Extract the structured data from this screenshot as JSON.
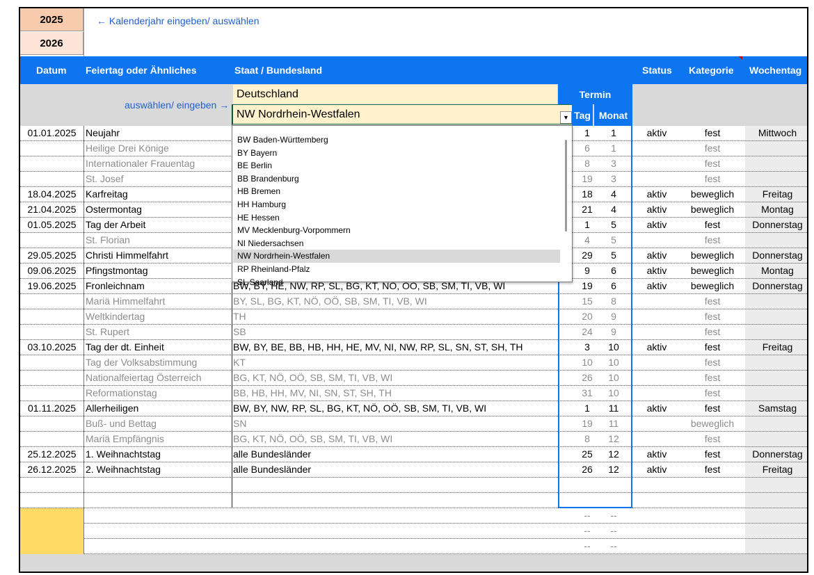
{
  "years": [
    "2025",
    "2026"
  ],
  "year_hint": "← Kalenderjahr eingeben/ auswählen",
  "headers": {
    "datum": "Datum",
    "feiertag": "Feiertag oder Ähnliches",
    "staat": "Staat / Bundesland",
    "status": "Status",
    "kategorie": "Kategorie",
    "wochentag": "Wochentag",
    "termin": "Termin",
    "tag": "Tag",
    "monat": "Monat"
  },
  "select_hint": "auswählen/ eingeben →",
  "country_value": "Deutschland",
  "state_value": "NW Nordrhein-Westfalen",
  "dropdown_arrow": "▼",
  "dropdown": {
    "items": [
      "BW Baden-Württemberg",
      "BY Bayern",
      "BE Berlin",
      "BB Brandenburg",
      "HB Bremen",
      "HH Hamburg",
      "HE Hessen",
      "MV Mecklenburg-Vorpommern",
      "NI Niedersachsen",
      "NW Nordrhein-Westfalen",
      "RP Rheinland-Pfalz",
      "SL Saarland"
    ],
    "selected_index": 9
  },
  "rows": [
    {
      "date": "01.01.2025",
      "name": "Neujahr",
      "states": "",
      "tag": "1",
      "monat": "1",
      "status": "aktiv",
      "kategorie": "fest",
      "wochentag": "Mittwoch",
      "gray": false
    },
    {
      "date": "",
      "name": "Heilige Drei Könige",
      "states": "",
      "tag": "6",
      "monat": "1",
      "status": "",
      "kategorie": "fest",
      "wochentag": "",
      "gray": true
    },
    {
      "date": "",
      "name": "Internationaler Frauentag",
      "states": "",
      "tag": "8",
      "monat": "3",
      "status": "",
      "kategorie": "fest",
      "wochentag": "",
      "gray": true
    },
    {
      "date": "",
      "name": "St. Josef",
      "states": "",
      "tag": "19",
      "monat": "3",
      "status": "",
      "kategorie": "fest",
      "wochentag": "",
      "gray": true
    },
    {
      "date": "18.04.2025",
      "name": "Karfreitag",
      "states": "",
      "tag": "18",
      "monat": "4",
      "status": "aktiv",
      "kategorie": "beweglich",
      "wochentag": "Freitag",
      "gray": false
    },
    {
      "date": "21.04.2025",
      "name": "Ostermontag",
      "states": "",
      "tag": "21",
      "monat": "4",
      "status": "aktiv",
      "kategorie": "beweglich",
      "wochentag": "Montag",
      "gray": false
    },
    {
      "date": "01.05.2025",
      "name": "Tag der Arbeit",
      "states": "",
      "tag": "1",
      "monat": "5",
      "status": "aktiv",
      "kategorie": "fest",
      "wochentag": "Donnerstag",
      "gray": false
    },
    {
      "date": "",
      "name": "St. Florian",
      "states": "",
      "tag": "4",
      "monat": "5",
      "status": "",
      "kategorie": "fest",
      "wochentag": "",
      "gray": true
    },
    {
      "date": "29.05.2025",
      "name": "Christi Himmelfahrt",
      "states": "",
      "tag": "29",
      "monat": "5",
      "status": "aktiv",
      "kategorie": "beweglich",
      "wochentag": "Donnerstag",
      "gray": false
    },
    {
      "date": "09.06.2025",
      "name": "Pfingstmontag",
      "states": "",
      "tag": "9",
      "monat": "6",
      "status": "aktiv",
      "kategorie": "beweglich",
      "wochentag": "Montag",
      "gray": false
    },
    {
      "date": "19.06.2025",
      "name": "Fronleichnam",
      "states": "BW, BY, HE, NW, RP, SL, BG, KT, NÖ, OÖ, SB, SM, TI, VB, WI",
      "tag": "19",
      "monat": "6",
      "status": "aktiv",
      "kategorie": "beweglich",
      "wochentag": "Donnerstag",
      "gray": false
    },
    {
      "date": "",
      "name": "Mariä Himmelfahrt",
      "states": "BY, SL, BG, KT, NÖ, OÖ, SB, SM, TI, VB, WI",
      "tag": "15",
      "monat": "8",
      "status": "",
      "kategorie": "fest",
      "wochentag": "",
      "gray": true
    },
    {
      "date": "",
      "name": "Weltkindertag",
      "states": "TH",
      "tag": "20",
      "monat": "9",
      "status": "",
      "kategorie": "fest",
      "wochentag": "",
      "gray": true
    },
    {
      "date": "",
      "name": "St. Rupert",
      "states": "SB",
      "tag": "24",
      "monat": "9",
      "status": "",
      "kategorie": "fest",
      "wochentag": "",
      "gray": true
    },
    {
      "date": "03.10.2025",
      "name": "Tag der dt. Einheit",
      "states": "BW, BY, BE, BB, HB, HH, HE, MV, NI, NW, RP, SL, SN, ST, SH, TH",
      "tag": "3",
      "monat": "10",
      "status": "aktiv",
      "kategorie": "fest",
      "wochentag": "Freitag",
      "gray": false
    },
    {
      "date": "",
      "name": "Tag der Volksabstimmung",
      "states": "KT",
      "tag": "10",
      "monat": "10",
      "status": "",
      "kategorie": "fest",
      "wochentag": "",
      "gray": true
    },
    {
      "date": "",
      "name": "Nationalfeiertag Österreich",
      "states": "BG, KT, NÖ, OÖ, SB, SM, TI, VB, WI",
      "tag": "26",
      "monat": "10",
      "status": "",
      "kategorie": "fest",
      "wochentag": "",
      "gray": true
    },
    {
      "date": "",
      "name": "Reformationstag",
      "states": "BB, HB, HH, MV, NI, SN, ST, SH, TH",
      "tag": "31",
      "monat": "10",
      "status": "",
      "kategorie": "fest",
      "wochentag": "",
      "gray": true
    },
    {
      "date": "01.11.2025",
      "name": "Allerheiligen",
      "states": "BW, BY, NW, RP, SL, BG, KT, NÖ, OÖ, SB, SM, TI, VB, WI",
      "tag": "1",
      "monat": "11",
      "status": "aktiv",
      "kategorie": "fest",
      "wochentag": "Samstag",
      "gray": false
    },
    {
      "date": "",
      "name": "Buß- und Bettag",
      "states": "SN",
      "tag": "19",
      "monat": "11",
      "status": "",
      "kategorie": "beweglich",
      "wochentag": "",
      "gray": true
    },
    {
      "date": "",
      "name": "Mariä Empfängnis",
      "states": "BG, KT, NÖ, OÖ, SB, SM, TI, VB, WI",
      "tag": "8",
      "monat": "12",
      "status": "",
      "kategorie": "fest",
      "wochentag": "",
      "gray": true
    },
    {
      "date": "25.12.2025",
      "name": "1. Weihnachtstag",
      "states": "alle Bundesländer",
      "tag": "25",
      "monat": "12",
      "status": "aktiv",
      "kategorie": "fest",
      "wochentag": "Donnerstag",
      "gray": false
    },
    {
      "date": "26.12.2025",
      "name": "2. Weihnachtstag",
      "states": "alle Bundesländer",
      "tag": "26",
      "monat": "12",
      "status": "aktiv",
      "kategorie": "fest",
      "wochentag": "Freitag",
      "gray": false
    },
    {
      "date": "",
      "name": "",
      "states": "",
      "tag": "",
      "monat": "",
      "status": "",
      "kategorie": "",
      "wochentag": "",
      "gray": false
    },
    {
      "date": "",
      "name": "",
      "states": "",
      "tag": "",
      "monat": "",
      "status": "",
      "kategorie": "",
      "wochentag": "",
      "gray": false
    },
    {
      "date": "",
      "name": "",
      "states": "",
      "tag": "--",
      "monat": "--",
      "status": "",
      "kategorie": "",
      "wochentag": "",
      "gray": true,
      "yellow": true
    },
    {
      "date": "",
      "name": "",
      "states": "",
      "tag": "--",
      "monat": "--",
      "status": "",
      "kategorie": "",
      "wochentag": "",
      "gray": true,
      "yellow": true
    },
    {
      "date": "",
      "name": "",
      "states": "",
      "tag": "--",
      "monat": "--",
      "status": "",
      "kategorie": "",
      "wochentag": "",
      "gray": true,
      "yellow": true
    }
  ],
  "colors": {
    "header_blue": "#0d75f0",
    "hint_blue": "#1f5fd0",
    "year_active": "#f8cbad",
    "year_next": "#fce4d6",
    "input_yellow": "#fff2cc",
    "empty_date_yellow": "#ffd966"
  }
}
